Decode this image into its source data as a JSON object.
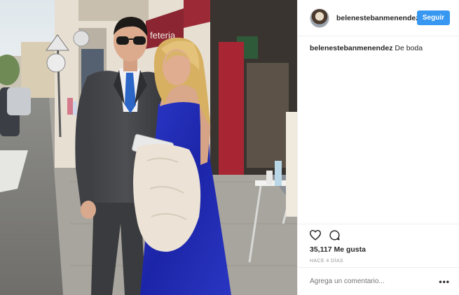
{
  "header": {
    "username": "belenestebanmenendez",
    "follow_label": "Seguir"
  },
  "caption": {
    "username": "belenestebanmenendez",
    "text": "De boda"
  },
  "photo": {
    "shop_sign": "feteria"
  },
  "actions": {
    "like_icon": "heart-icon",
    "comment_icon": "comment-icon"
  },
  "likes_text": "35,117 Me gusta",
  "time_text": "HACE 4 DÍAS",
  "comment": {
    "placeholder": "Agrega un comentario..."
  },
  "more_label": "•••",
  "colors": {
    "accent": "#3897f0",
    "text": "#262626",
    "muted": "#999999",
    "border": "#efefef"
  }
}
